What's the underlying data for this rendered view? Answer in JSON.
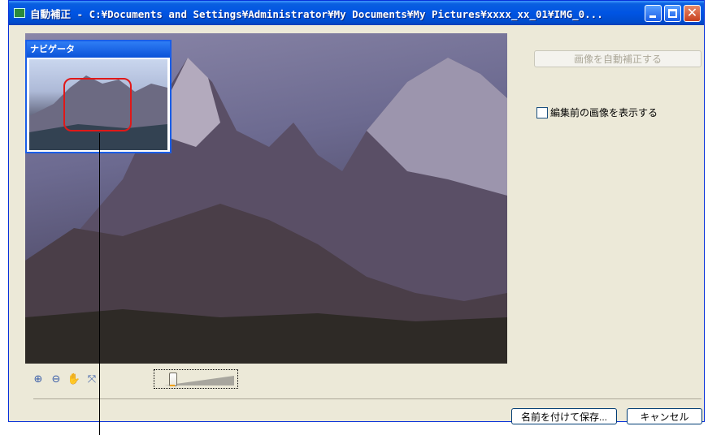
{
  "window": {
    "title": "自動補正 - C:¥Documents and Settings¥Administrator¥My Documents¥My Pictures¥xxxx_xx_01¥IMG_0...",
    "icon": "image-app-icon"
  },
  "titlebar_buttons": {
    "minimize": "minimize-icon",
    "maximize": "maximize-icon",
    "close": "close-icon",
    "close_glyph": "✕"
  },
  "navigator": {
    "title": "ナビゲータ"
  },
  "right_panel": {
    "auto_correct_button": "画像を自動補正する",
    "show_original_checkbox": {
      "label": "編集前の画像を表示する",
      "checked": false
    }
  },
  "toolbar": {
    "zoom_in": "zoom-in-icon",
    "zoom_out": "zoom-out-icon",
    "hand": "hand-pan-icon",
    "fit": "fit-to-window-icon",
    "zoom_slider_level": 0.12
  },
  "footer": {
    "save_as_button": "名前を付けて保存...",
    "cancel_button": "キャンセル"
  },
  "colors": {
    "titlebar": "#0054e3",
    "close_button": "#c8401e",
    "nav_frame": "#e01818",
    "window_bg": "#ece9d8"
  }
}
